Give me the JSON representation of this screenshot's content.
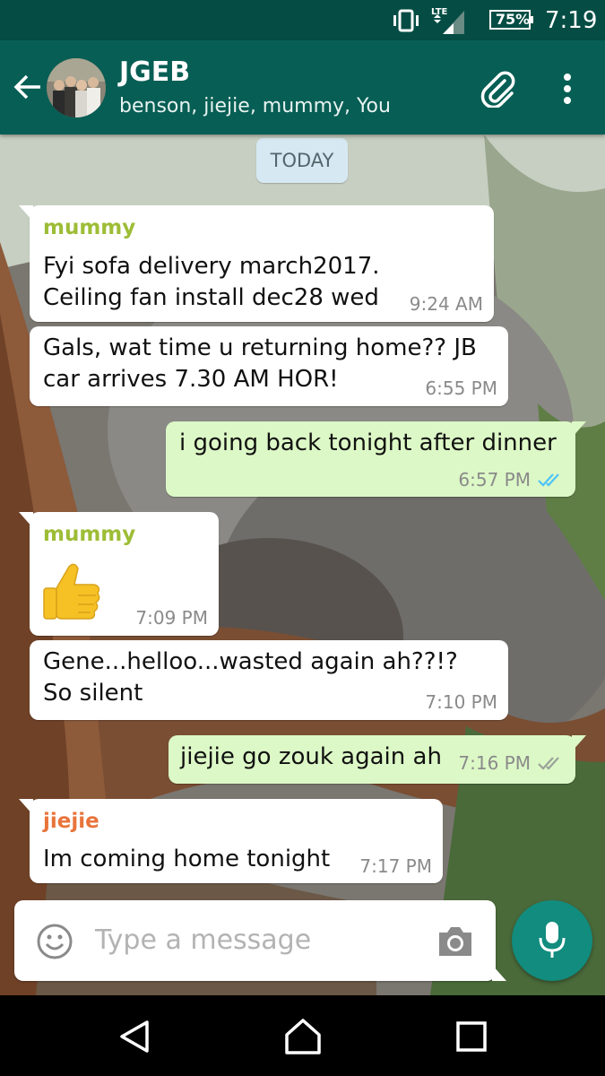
{
  "status_bar": {
    "network": "LTE",
    "battery": "75%",
    "time": "7:19"
  },
  "header": {
    "title": "JGEB",
    "members": "benson, jiejie, mummy, You"
  },
  "chat": {
    "date_chip": "TODAY",
    "messages": [
      {
        "direction": "in",
        "sender": "mummy",
        "sender_color": "#9dbd36",
        "lines": [
          "Fyi sofa delivery march2017.",
          "Ceiling fan install dec28 wed"
        ],
        "time": "9:24 AM"
      },
      {
        "direction": "in",
        "sender": "",
        "lines": [
          "Gals, wat time u returning home?? JB",
          "car arrives 7.30 AM HOR!"
        ],
        "time": "6:55 PM"
      },
      {
        "direction": "out",
        "lines": [
          "i going back tonight after dinner"
        ],
        "time": "6:57 PM",
        "status": "read"
      },
      {
        "direction": "in",
        "sender": "mummy",
        "sender_color": "#9dbd36",
        "emoji": "thumbs-up",
        "time": "7:09 PM"
      },
      {
        "direction": "in",
        "sender": "",
        "lines": [
          "Gene...helloo...wasted again ah??!?",
          "So silent"
        ],
        "time": "7:10 PM"
      },
      {
        "direction": "out",
        "lines": [
          "jiejie go zouk again ah"
        ],
        "time": "7:16 PM",
        "status": "delivered"
      },
      {
        "direction": "in",
        "sender": "jiejie",
        "sender_color": "#e8743b",
        "lines": [
          "Im coming home tonight"
        ],
        "time": "7:17 PM"
      }
    ]
  },
  "composer": {
    "placeholder": "Type a message"
  },
  "colors": {
    "toolbar": "#075e54",
    "status_bar": "#054d44",
    "outgoing_bubble": "#dcf8c6",
    "incoming_bubble": "#ffffff",
    "read_ticks": "#4fc3f7",
    "delivered_ticks": "#9aa39a",
    "mic_button": "#128c7e"
  },
  "icons": [
    "vibrate-icon",
    "signal-icon",
    "battery-icon",
    "back-arrow-icon",
    "attach-icon",
    "overflow-menu-icon",
    "emoji-icon",
    "camera-icon",
    "mic-icon",
    "nav-back-icon",
    "nav-home-icon",
    "nav-recents-icon"
  ]
}
